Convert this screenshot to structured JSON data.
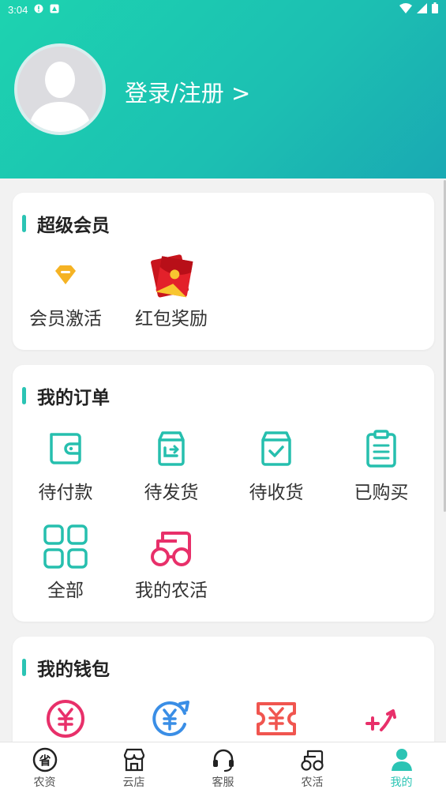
{
  "status": {
    "time": "3:04"
  },
  "header": {
    "login_text": "登录/注册 >"
  },
  "vip": {
    "title": "超级会员",
    "items": [
      {
        "label": "会员激活",
        "icon": "diamond-icon"
      },
      {
        "label": "红包奖励",
        "icon": "red-envelope-icon"
      }
    ]
  },
  "orders": {
    "title": "我的订单",
    "items": [
      {
        "label": "待付款",
        "icon": "wallet-icon"
      },
      {
        "label": "待发货",
        "icon": "ship-box-icon"
      },
      {
        "label": "待收货",
        "icon": "receive-box-icon"
      },
      {
        "label": "已购买",
        "icon": "clipboard-icon"
      },
      {
        "label": "全部",
        "icon": "grid-icon"
      },
      {
        "label": "我的农活",
        "icon": "tractor-icon"
      }
    ]
  },
  "wallet": {
    "title": "我的钱包",
    "icons": [
      "yuan-circle-icon",
      "yuan-refresh-icon",
      "yuan-ticket-icon",
      "plus-arrow-icon"
    ]
  },
  "tabs": [
    {
      "label": "农资",
      "icon": "province-icon"
    },
    {
      "label": "云店",
      "icon": "store-icon"
    },
    {
      "label": "客服",
      "icon": "headset-icon"
    },
    {
      "label": "农活",
      "icon": "tractor-icon"
    },
    {
      "label": "我的",
      "icon": "user-icon",
      "active": true
    }
  ],
  "colors": {
    "accent": "#2bc4b4",
    "teal_icon": "#26bfae",
    "pink": "#e8306a",
    "blue": "#3a8ee6",
    "red": "#f0554f"
  }
}
